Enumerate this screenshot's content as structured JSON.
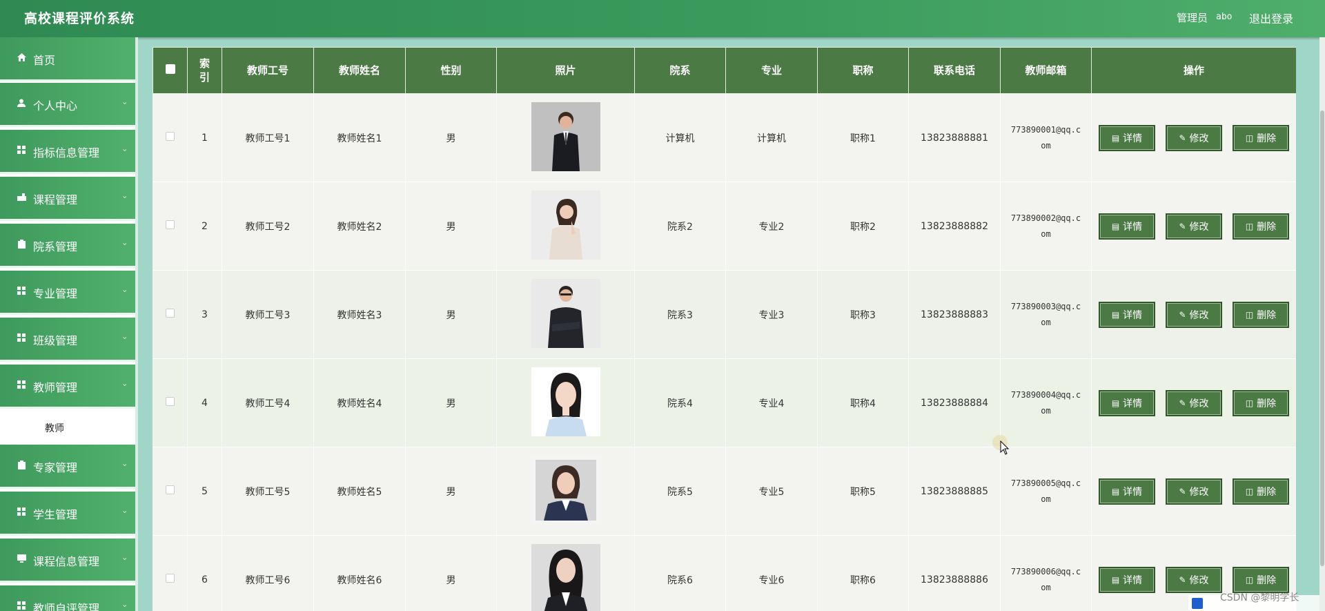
{
  "header": {
    "title": "高校课程评价系统",
    "role": "管理员",
    "username": "abo",
    "logout": "退出登录"
  },
  "sidebar": {
    "items": [
      {
        "label": "首页",
        "icon": "home-icon",
        "chevron": false
      },
      {
        "label": "个人中心",
        "icon": "user-icon",
        "chevron": true
      },
      {
        "label": "指标信息管理",
        "icon": "grid-icon",
        "chevron": true
      },
      {
        "label": "课程管理",
        "icon": "course-icon",
        "chevron": true
      },
      {
        "label": "院系管理",
        "icon": "clipboard-icon",
        "chevron": true
      },
      {
        "label": "专业管理",
        "icon": "grid-icon",
        "chevron": true
      },
      {
        "label": "班级管理",
        "icon": "grid-icon",
        "chevron": true
      },
      {
        "label": "教师管理",
        "icon": "grid-icon",
        "chevron": true
      }
    ],
    "subitem": "教师",
    "items_after": [
      {
        "label": "专家管理",
        "icon": "clipboard-icon",
        "chevron": true
      },
      {
        "label": "学生管理",
        "icon": "grid-icon",
        "chevron": true
      },
      {
        "label": "课程信息管理",
        "icon": "monitor-icon",
        "chevron": true
      },
      {
        "label": "教师自评管理",
        "icon": "grid-icon",
        "chevron": true
      }
    ]
  },
  "table": {
    "headers": [
      "",
      "索引",
      "教师工号",
      "教师姓名",
      "性别",
      "照片",
      "院系",
      "专业",
      "职称",
      "联系电话",
      "教师邮箱",
      "操作"
    ],
    "rows": [
      {
        "index": "1",
        "id": "教师工号1",
        "name": "教师姓名1",
        "gender": "男",
        "dept": "计算机",
        "major": "计算机",
        "title": "职称1",
        "phone": "13823888881",
        "email": "773890001@qq.com"
      },
      {
        "index": "2",
        "id": "教师工号2",
        "name": "教师姓名2",
        "gender": "男",
        "dept": "院系2",
        "major": "专业2",
        "title": "职称2",
        "phone": "13823888882",
        "email": "773890002@qq.com"
      },
      {
        "index": "3",
        "id": "教师工号3",
        "name": "教师姓名3",
        "gender": "男",
        "dept": "院系3",
        "major": "专业3",
        "title": "职称3",
        "phone": "13823888883",
        "email": "773890003@qq.com"
      },
      {
        "index": "4",
        "id": "教师工号4",
        "name": "教师姓名4",
        "gender": "男",
        "dept": "院系4",
        "major": "专业4",
        "title": "职称4",
        "phone": "13823888884",
        "email": "773890004@qq.com"
      },
      {
        "index": "5",
        "id": "教师工号5",
        "name": "教师姓名5",
        "gender": "男",
        "dept": "院系5",
        "major": "专业5",
        "title": "职称5",
        "phone": "13823888885",
        "email": "773890005@qq.com"
      },
      {
        "index": "6",
        "id": "教师工号6",
        "name": "教师姓名6",
        "gender": "男",
        "dept": "院系6",
        "major": "专业6",
        "title": "职称6",
        "phone": "13823888886",
        "email": "773890006@qq.com"
      }
    ],
    "actions": {
      "detail": "详情",
      "edit": "修改",
      "delete": "删除"
    }
  },
  "watermark": "CSDN @黎明学长",
  "colors": {
    "header": "#3a9a5c",
    "sidebar": "#4aa866",
    "table_header": "#4c7a45",
    "button": "#4c7a45"
  }
}
